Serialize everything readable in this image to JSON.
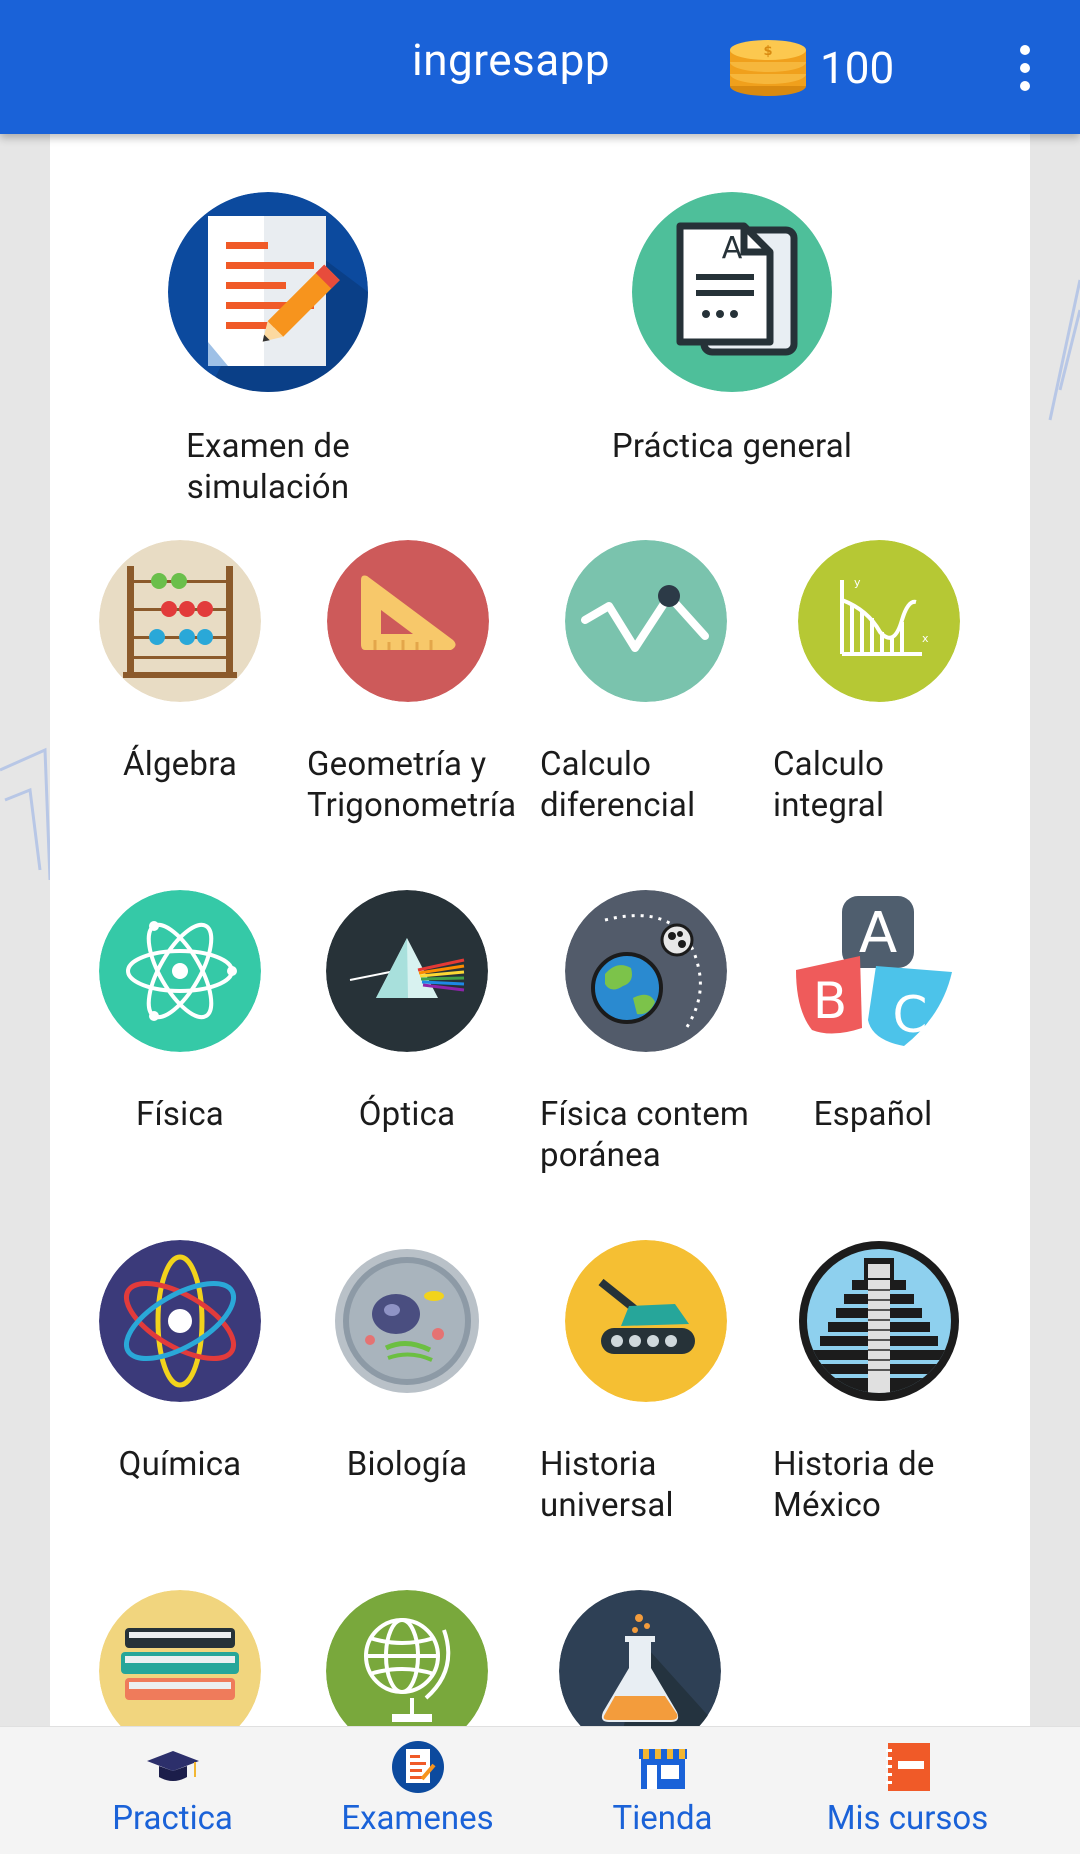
{
  "app_bar": {
    "title": "ingresapp",
    "coins": "100",
    "coins_icon": "coins-icon",
    "menu_icon": "more-vert-icon"
  },
  "tiles": {
    "examen": {
      "label": "Examen de simulación",
      "icon": "exam-document-icon",
      "color": "#0c4a9e"
    },
    "practica": {
      "label": "Práctica general",
      "icon": "documents-icon",
      "color": "#4ebf9a"
    },
    "algebra": {
      "label": "Álgebra",
      "icon": "abacus-icon",
      "color": "#e8dcc4"
    },
    "geometria": {
      "label_1": "Geometría y",
      "label_2": "Trigonometría",
      "icon": "set-square-icon",
      "color": "#cd5a5a"
    },
    "diferencial": {
      "label_1": "Calculo",
      "label_2": "diferencial",
      "icon": "line-graph-icon",
      "color": "#7ac3ad"
    },
    "integral": {
      "label_1": "Calculo",
      "label_2": "integral",
      "icon": "integral-graph-icon",
      "color": "#b6c834"
    },
    "fisica": {
      "label": "Física",
      "icon": "atom-icon",
      "color": "#35c9a7"
    },
    "optica": {
      "label": "Óptica",
      "icon": "prism-icon",
      "color": "#273238"
    },
    "fisica_contemporanea": {
      "label_1": "Física contem",
      "label_2": "poránea",
      "icon": "planet-orbit-icon",
      "color": "#525b6a"
    },
    "espanol": {
      "label": "Español",
      "icon": "abc-blocks-icon",
      "color": "#4f5e6e"
    },
    "quimica": {
      "label": "Química",
      "icon": "atom-orbit-icon",
      "color": "#3b3a7a"
    },
    "biologia": {
      "label": "Biología",
      "icon": "cell-icon",
      "color": "#b9c1c8"
    },
    "historia_universal": {
      "label_1": "Historia",
      "label_2": "universal",
      "icon": "tank-icon",
      "color": "#f5bf33"
    },
    "historia_mexico": {
      "label_1": "Historia de",
      "label_2": "México",
      "icon": "pyramid-icon",
      "color": "#1c1c1c"
    },
    "row5_1": {
      "icon": "books-icon",
      "color": "#f1d57e"
    },
    "row5_2": {
      "icon": "globe-icon",
      "color": "#79a83c"
    },
    "row5_3": {
      "icon": "flask-icon",
      "color": "#2e4055"
    }
  },
  "bottom_nav": {
    "items": [
      {
        "label": "Practica",
        "icon": "graduation-cap-icon"
      },
      {
        "label": "Examenes",
        "icon": "exam-icon"
      },
      {
        "label": "Tienda",
        "icon": "store-icon"
      },
      {
        "label": "Mis cursos",
        "icon": "courses-icon"
      }
    ],
    "active_color": "#1a62d8"
  }
}
